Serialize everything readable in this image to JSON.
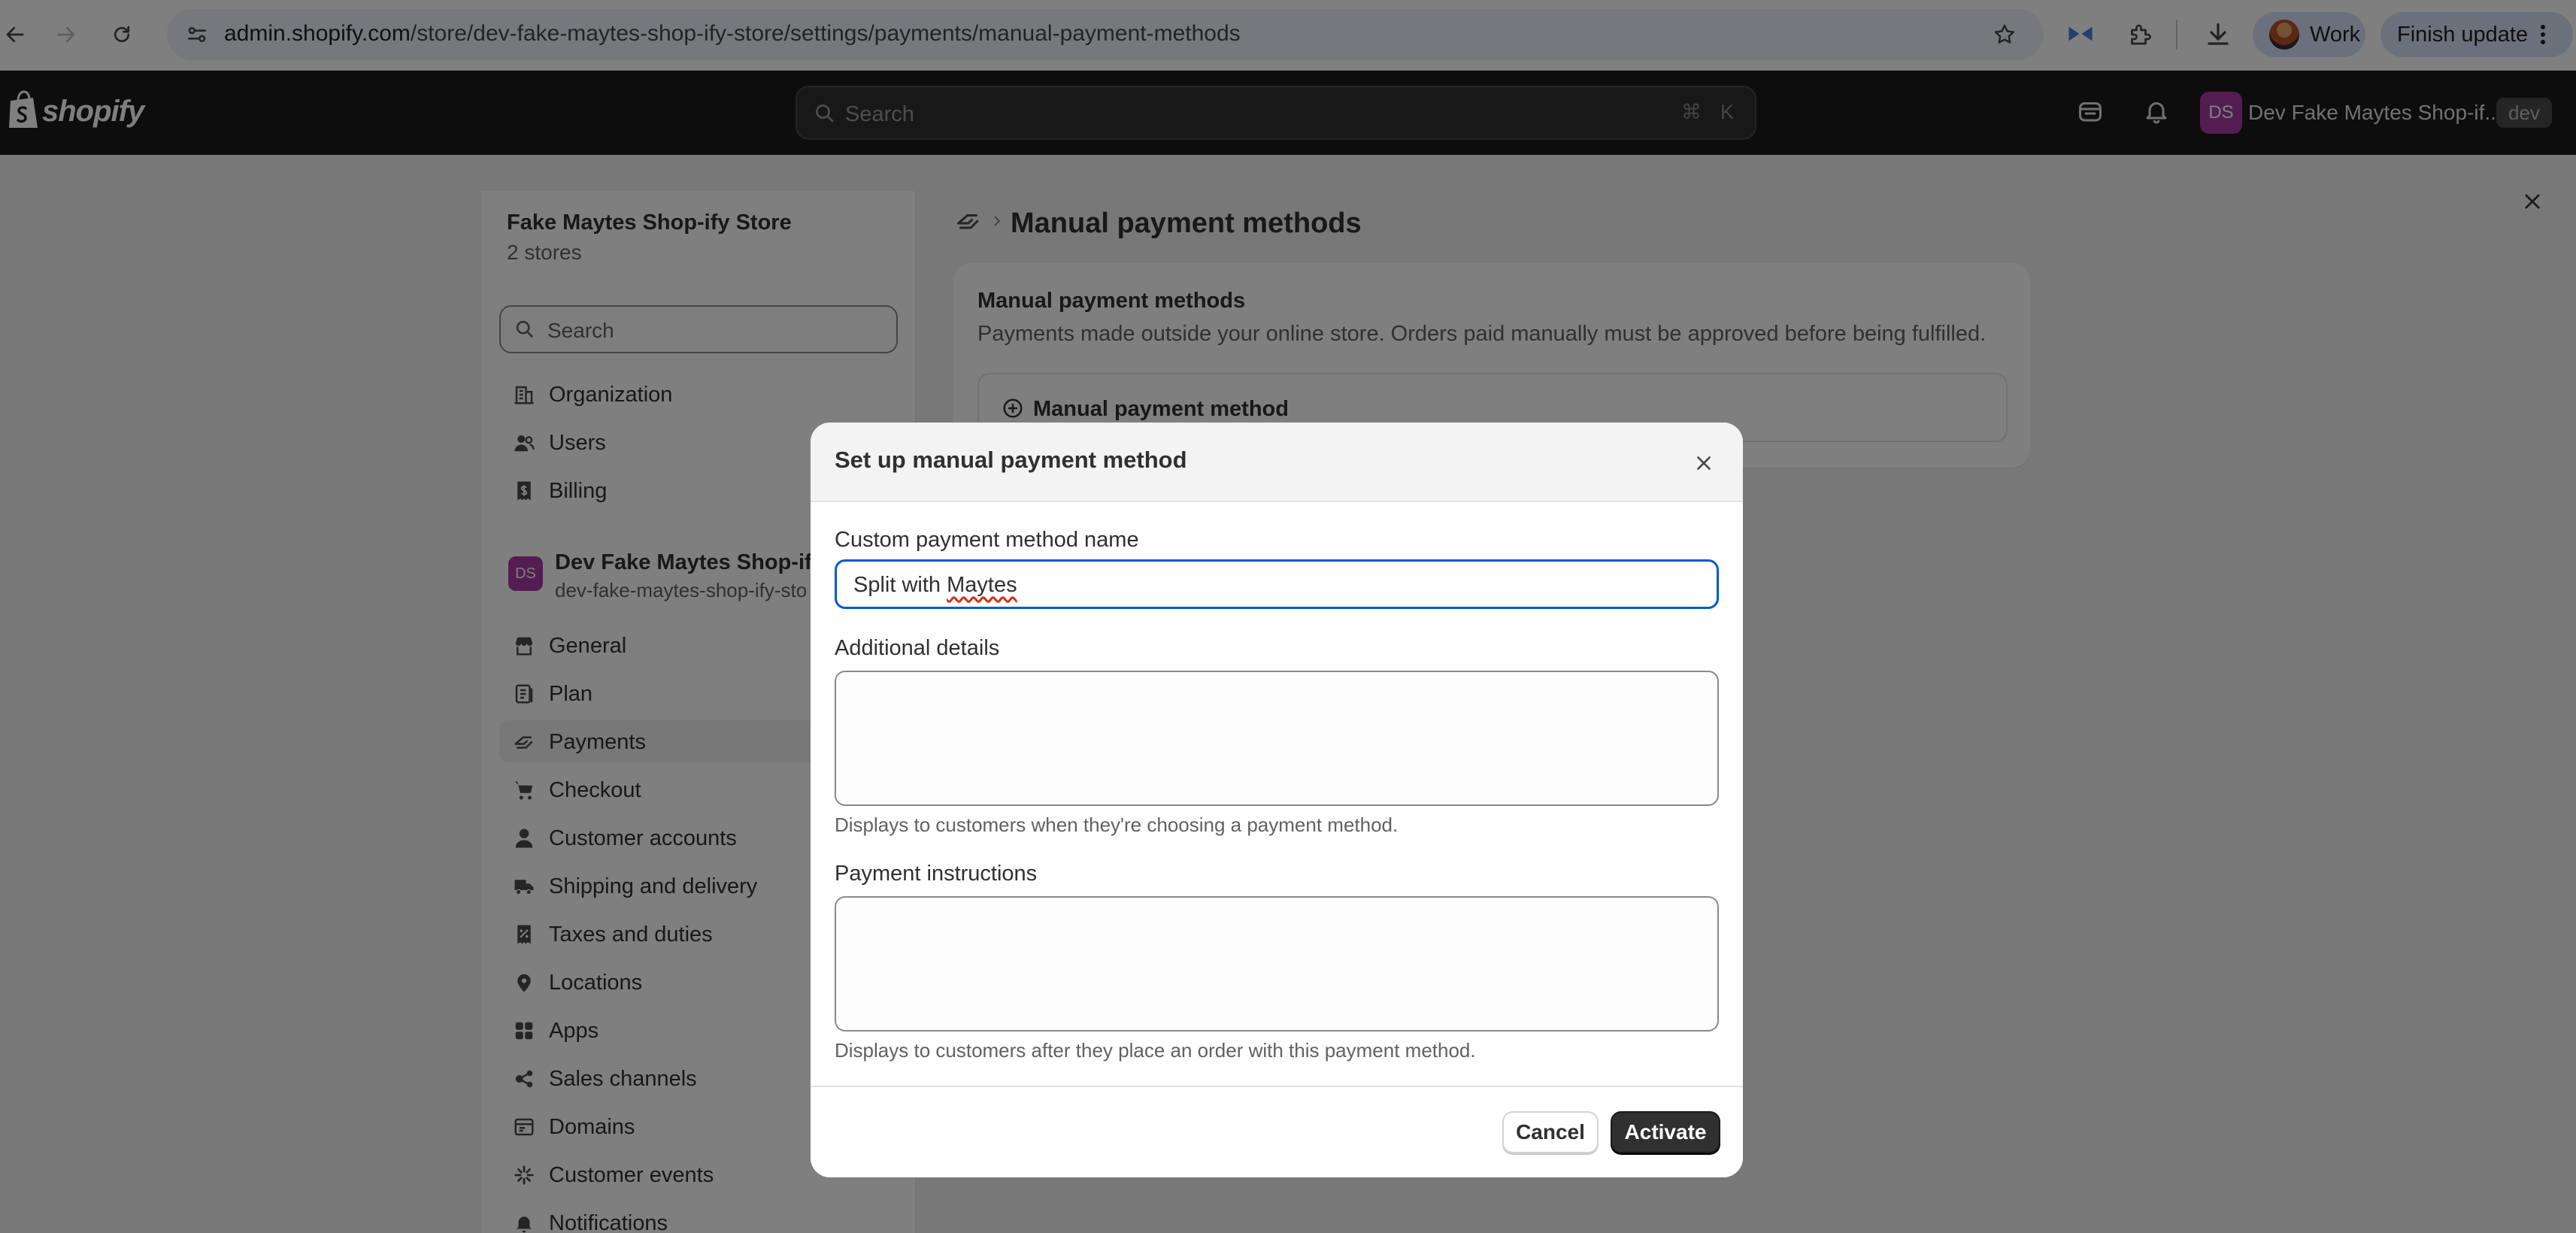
{
  "browser": {
    "url_host": "admin.shopify.com",
    "url_path": "/store/dev-fake-maytes-shop-ify-store/settings/payments/manual-payment-methods",
    "profile_label": "Work",
    "update_label": "Finish update"
  },
  "topbar": {
    "logo": "shopify",
    "search_placeholder": "Search",
    "shortcut_cmd": "⌘",
    "shortcut_key": "K",
    "account_initials": "DS",
    "account_name": "Dev Fake Maytes Shop-if...",
    "env_badge": "dev"
  },
  "sidebar": {
    "org_name": "Fake Maytes Shop-ify Store",
    "org_sub": "2 stores",
    "search_placeholder": "Search",
    "org_items": [
      {
        "label": "Organization",
        "icon": "building-icon"
      },
      {
        "label": "Users",
        "icon": "users-icon"
      },
      {
        "label": "Billing",
        "icon": "receipt-icon"
      }
    ],
    "store": {
      "initials": "DS",
      "name": "Dev Fake Maytes Shop-ify S",
      "handle": "dev-fake-maytes-shop-ify-sto"
    },
    "store_items": [
      {
        "label": "General",
        "icon": "store-icon"
      },
      {
        "label": "Plan",
        "icon": "plan-icon"
      },
      {
        "label": "Payments",
        "icon": "payments-icon",
        "active": true
      },
      {
        "label": "Checkout",
        "icon": "cart-icon"
      },
      {
        "label": "Customer accounts",
        "icon": "person-icon"
      },
      {
        "label": "Shipping and delivery",
        "icon": "truck-icon"
      },
      {
        "label": "Taxes and duties",
        "icon": "tax-icon"
      },
      {
        "label": "Locations",
        "icon": "location-icon"
      },
      {
        "label": "Apps",
        "icon": "apps-icon"
      },
      {
        "label": "Sales channels",
        "icon": "channels-icon"
      },
      {
        "label": "Domains",
        "icon": "globe-icon"
      },
      {
        "label": "Customer events",
        "icon": "sparkle-icon"
      },
      {
        "label": "Notifications",
        "icon": "bell-icon"
      }
    ]
  },
  "main": {
    "page_title": "Manual payment methods",
    "card_title": "Manual payment methods",
    "card_description": "Payments made outside your online store. Orders paid manually must be approved before being fulfilled.",
    "add_method_label": "Manual payment method"
  },
  "modal": {
    "title": "Set up manual payment method",
    "name_label": "Custom payment method name",
    "name_value_prefix": "Split with ",
    "name_value_misspelled": "Maytes",
    "details_label": "Additional details",
    "details_value": "",
    "details_help": "Displays to customers when they're choosing a payment method.",
    "instructions_label": "Payment instructions",
    "instructions_value": "",
    "instructions_help": "Displays to customers after they place an order with this payment method.",
    "cancel_label": "Cancel",
    "activate_label": "Activate"
  },
  "colors": {
    "topbar_bg": "#1a1a1a",
    "focus_border": "#005bd3",
    "primary_button": "#303030",
    "avatar": "#a93ba4"
  }
}
